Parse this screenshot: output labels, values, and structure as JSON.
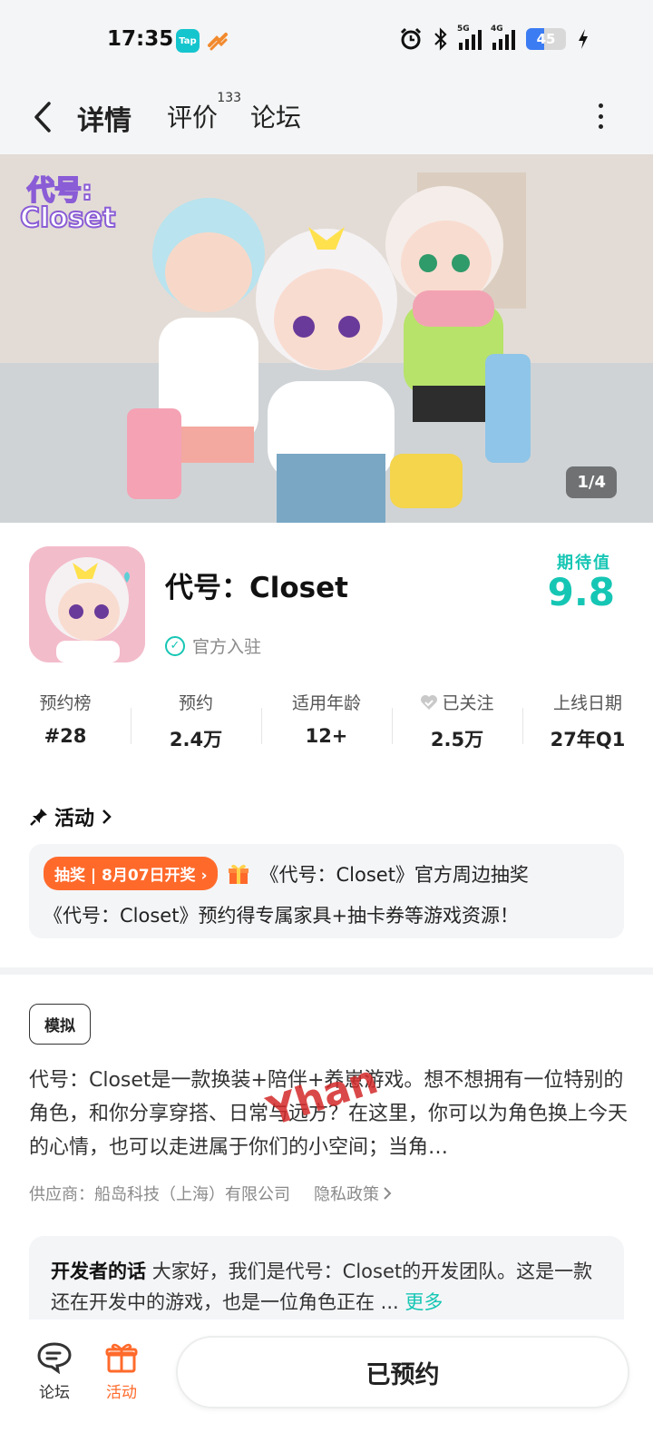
{
  "status_bar": {
    "time": "17:35",
    "tap_icon_label": "Tap",
    "network_1": "5G",
    "network_2": "4G",
    "battery": "45"
  },
  "nav": {
    "tabs": [
      {
        "label": "详情",
        "active": true
      },
      {
        "label": "评价",
        "badge": "133"
      },
      {
        "label": "论坛"
      }
    ]
  },
  "banner": {
    "logo_line1": "代号:",
    "logo_line2": "Closet",
    "counter": "1/4"
  },
  "app": {
    "title": "代号：Closet",
    "official_label": "官方入驻",
    "expect_label": "期待值",
    "expect_score": "9.8",
    "accent_color": "#16c6b4"
  },
  "stats": [
    {
      "label": "预约榜",
      "value": "#28"
    },
    {
      "label": "预约",
      "value": "2.4万"
    },
    {
      "label": "适用年龄",
      "value": "12+"
    },
    {
      "label": "已关注",
      "value": "2.5万",
      "icon": "heart-check-icon"
    },
    {
      "label": "上线日期",
      "value": "27年Q1"
    }
  ],
  "activity": {
    "title": "活动",
    "badge": "抽奖 | 8月07日开奖",
    "line1": "《代号：Closet》官方周边抽奖",
    "line2": "《代号：Closet》预约得专属家具+抽卡券等游戏资源！",
    "badge_color": "#ff6a2b"
  },
  "details": {
    "tag": "模拟",
    "description": "代号：Closet是一款换装+陪伴+养崽游戏。想不想拥有一位特别的角色，和你分享穿搭、日常与远方？在这里，你可以为角色换上今天的心情，也可以走进属于你们的小空间；当角…",
    "watermark": "Yhan",
    "provider": "供应商：船岛科技（上海）有限公司",
    "privacy": "隐私政策"
  },
  "developer": {
    "title": "开发者的话",
    "text": "大家好，我们是代号：Closet的开发团队。这是一款还在开发中的游戏，也是一位角色正在 ...",
    "more": "更多"
  },
  "bottom_bar": {
    "forum": "论坛",
    "activity": "活动",
    "reserve_button": "已预约"
  }
}
